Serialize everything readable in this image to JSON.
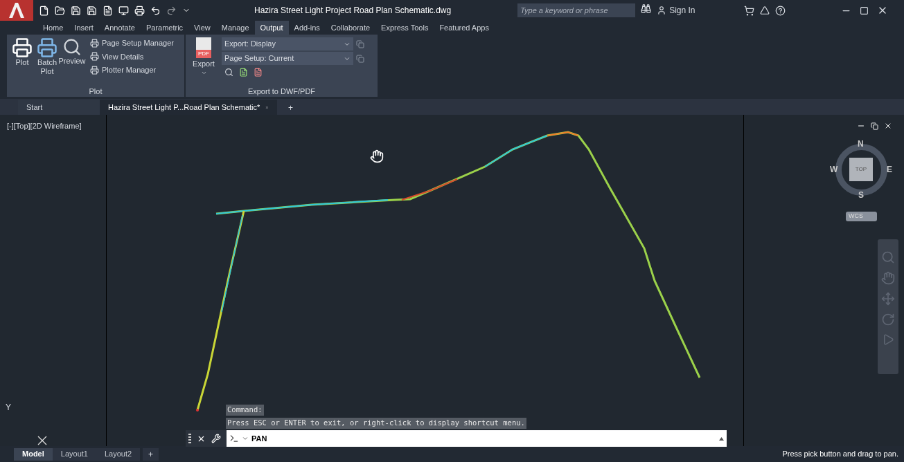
{
  "window": {
    "title": "Hazira Street Light Project Road Plan Schematic.dwg"
  },
  "search": {
    "placeholder": "Type a keyword or phrase"
  },
  "sign_in": "Sign In",
  "ribbon_tabs": [
    {
      "label": "Home",
      "selected": false
    },
    {
      "label": "Insert",
      "selected": false
    },
    {
      "label": "Annotate",
      "selected": false
    },
    {
      "label": "Parametric",
      "selected": false
    },
    {
      "label": "View",
      "selected": false
    },
    {
      "label": "Manage",
      "selected": false
    },
    {
      "label": "Output",
      "selected": true
    },
    {
      "label": "Add-ins",
      "selected": false
    },
    {
      "label": "Collaborate",
      "selected": false
    },
    {
      "label": "Express Tools",
      "selected": false
    },
    {
      "label": "Featured Apps",
      "selected": false
    }
  ],
  "plot_panel": {
    "title": "Plot",
    "large_buttons": [
      {
        "label": "Plot",
        "kind": "plot"
      },
      {
        "label": "Batch Plot",
        "kind": "batch"
      },
      {
        "label": "Preview",
        "kind": "preview"
      }
    ],
    "small_buttons": [
      "Page Setup Manager",
      "View Details",
      "Plotter Manager"
    ]
  },
  "export_panel": {
    "title": "Export to DWF/PDF",
    "export_button": "Export",
    "export_icon_text": "PDF",
    "dropdowns": [
      "Export: Display",
      "Page Setup: Current"
    ]
  },
  "file_tabs": [
    {
      "label": "Start",
      "selected": false
    },
    {
      "label": "Hazira Street Light P...Road Plan Schematic*",
      "selected": true
    }
  ],
  "new_tab": "+",
  "viewport": {
    "label": "[-][Top][2D Wireframe]",
    "axis_label": "Y",
    "compass": {
      "north": "N",
      "south": "S",
      "east": "E",
      "west": "W",
      "cube": "TOP",
      "ucs": "WCS"
    }
  },
  "command_history": [
    "Command:",
    "Press ESC or ENTER to exit, or right-click to display shortcut menu."
  ],
  "command_input": {
    "value": "PAN"
  },
  "layout_tabs": [
    {
      "label": "Model",
      "selected": true
    },
    {
      "label": "Layout1",
      "selected": false
    },
    {
      "label": "Layout2",
      "selected": false
    }
  ],
  "new_layout": "+",
  "status_message": "Press pick button and drag to pan."
}
